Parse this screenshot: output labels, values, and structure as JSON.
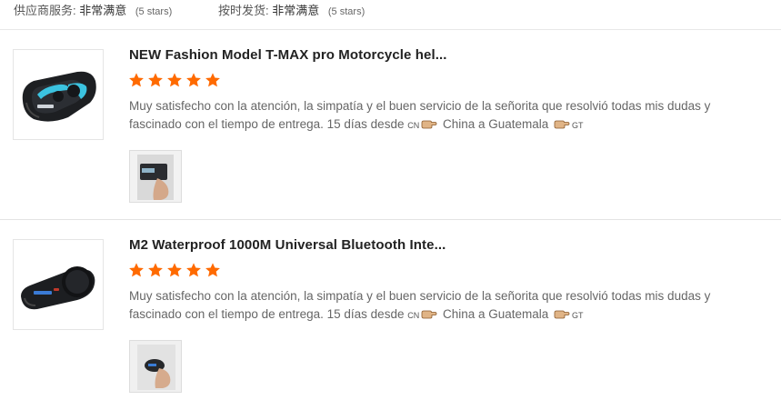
{
  "ratings": {
    "supplier_service": {
      "label": "供应商服务:",
      "value": "非常满意",
      "stars": "(5 stars)"
    },
    "shipping_on_time": {
      "label": "按时发货:",
      "value": "非常满意",
      "stars": "(5 stars)"
    }
  },
  "reviews": [
    {
      "product_title": "NEW Fashion Model T-MAX pro Motorcycle hel...",
      "rating": 5,
      "text_part1": "Muy satisfecho con la atención, la simpatía y el buen servicio de la señorita que resolvió todas mis dudas y fascinado con el tiempo de entrega. 15 días desde ",
      "from_code": "CN",
      "middle": " China a Guatemala ",
      "to_code": "GT",
      "product_image": "tmax-intercom-image",
      "photo": "customer-photo"
    },
    {
      "product_title": "M2 Waterproof 1000M Universal Bluetooth Inte...",
      "rating": 5,
      "text_part1": "Muy satisfecho con la atención, la simpatía y el buen servicio de la señorita que resolvió todas mis dudas y fascinado con el tiempo de entrega. 15 días desde ",
      "from_code": "CN",
      "middle": " China a Guatemala ",
      "to_code": "GT",
      "product_image": "m2-intercom-image",
      "photo": "customer-photo"
    }
  ],
  "colors": {
    "star": "#ff6a00",
    "title": "#222222",
    "text": "#666666",
    "divider": "#e3e3e3"
  },
  "icons": {
    "star": "star-icon",
    "pointing_hand": "pointing-hand-icon"
  }
}
